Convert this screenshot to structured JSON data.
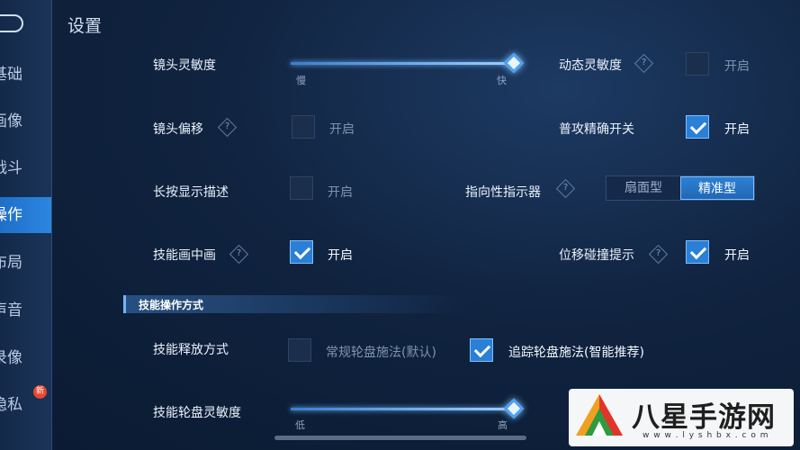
{
  "header": {
    "title": "设置"
  },
  "sidebar": {
    "items": [
      {
        "label": "基础",
        "active": false
      },
      {
        "label": "画像",
        "active": false
      },
      {
        "label": "战斗",
        "active": false
      },
      {
        "label": "操作",
        "active": true
      },
      {
        "label": "布局",
        "active": false
      },
      {
        "label": "声音",
        "active": false
      },
      {
        "label": "录像",
        "active": false
      },
      {
        "label": "权限/隐私",
        "active": false
      }
    ],
    "new_badge": "新"
  },
  "settings": {
    "camera_sensitivity": {
      "label": "镜头灵敏度",
      "min_label": "慢",
      "max_label": "快",
      "value": 1.0
    },
    "dynamic_sensitivity": {
      "label": "动态灵敏度",
      "option": "开启",
      "checked": false
    },
    "camera_offset": {
      "label": "镜头偏移",
      "option": "开启",
      "checked": false
    },
    "attack_precision": {
      "label": "普攻精确开关",
      "option": "开启",
      "checked": true
    },
    "long_press_desc": {
      "label": "长按显示描述",
      "option": "开启",
      "checked": false
    },
    "directional_indicator": {
      "label": "指向性指示器",
      "options": [
        "扇面型",
        "精准型"
      ],
      "selected": 1
    },
    "skill_pip": {
      "label": "技能画中画",
      "option": "开启",
      "checked": true
    },
    "move_collision": {
      "label": "位移碰撞提示",
      "option": "开启",
      "checked": true
    }
  },
  "skill_section": {
    "title": "技能操作方式",
    "cast_mode": {
      "label": "技能释放方式",
      "option_normal": "常规轮盘施法(默认)",
      "normal_checked": false,
      "option_tracking": "追踪轮盘施法(智能推荐)",
      "tracking_checked": true
    },
    "wheel_sensitivity": {
      "label": "技能轮盘灵敏度",
      "min_label": "低",
      "max_label": "高",
      "value": 1.0
    }
  },
  "help_glyph": "?",
  "watermark": {
    "name": "八星手游网",
    "url": "w w w . l y s h b x . c o m"
  },
  "colors": {
    "accent": "#2a7fd6",
    "background": "#10233f"
  }
}
